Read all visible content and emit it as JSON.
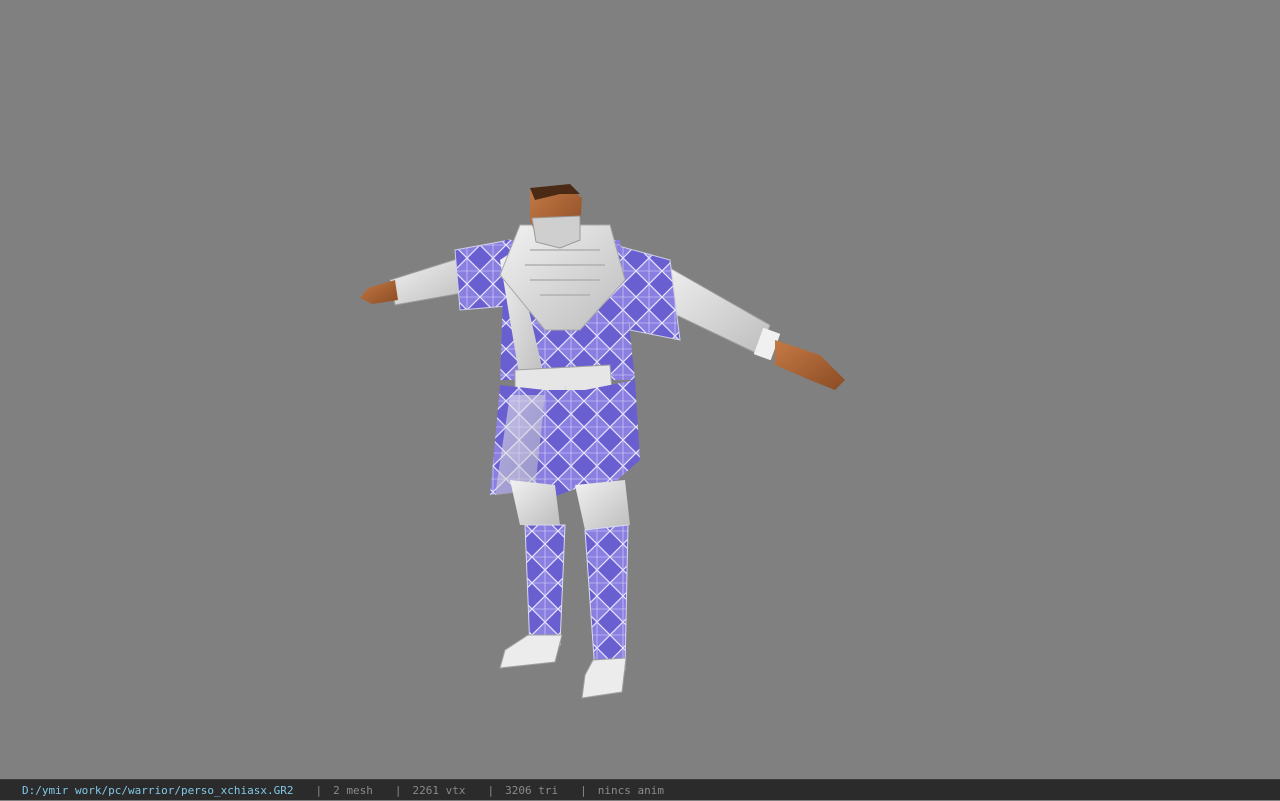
{
  "viewport": {
    "background_color": "#808080",
    "model_icon": "warrior-character-model"
  },
  "statusbar": {
    "file_path": "D:/ymir work/pc/warrior/perso_xchiasx.GR2",
    "separator": "|",
    "mesh_count": "2 mesh",
    "vertex_count": "2261 vtx",
    "triangle_count": "3206 tri",
    "anim_label": "nincs anim",
    "path_color": "#7fc8e8",
    "text_color": "#8a8a8a"
  }
}
